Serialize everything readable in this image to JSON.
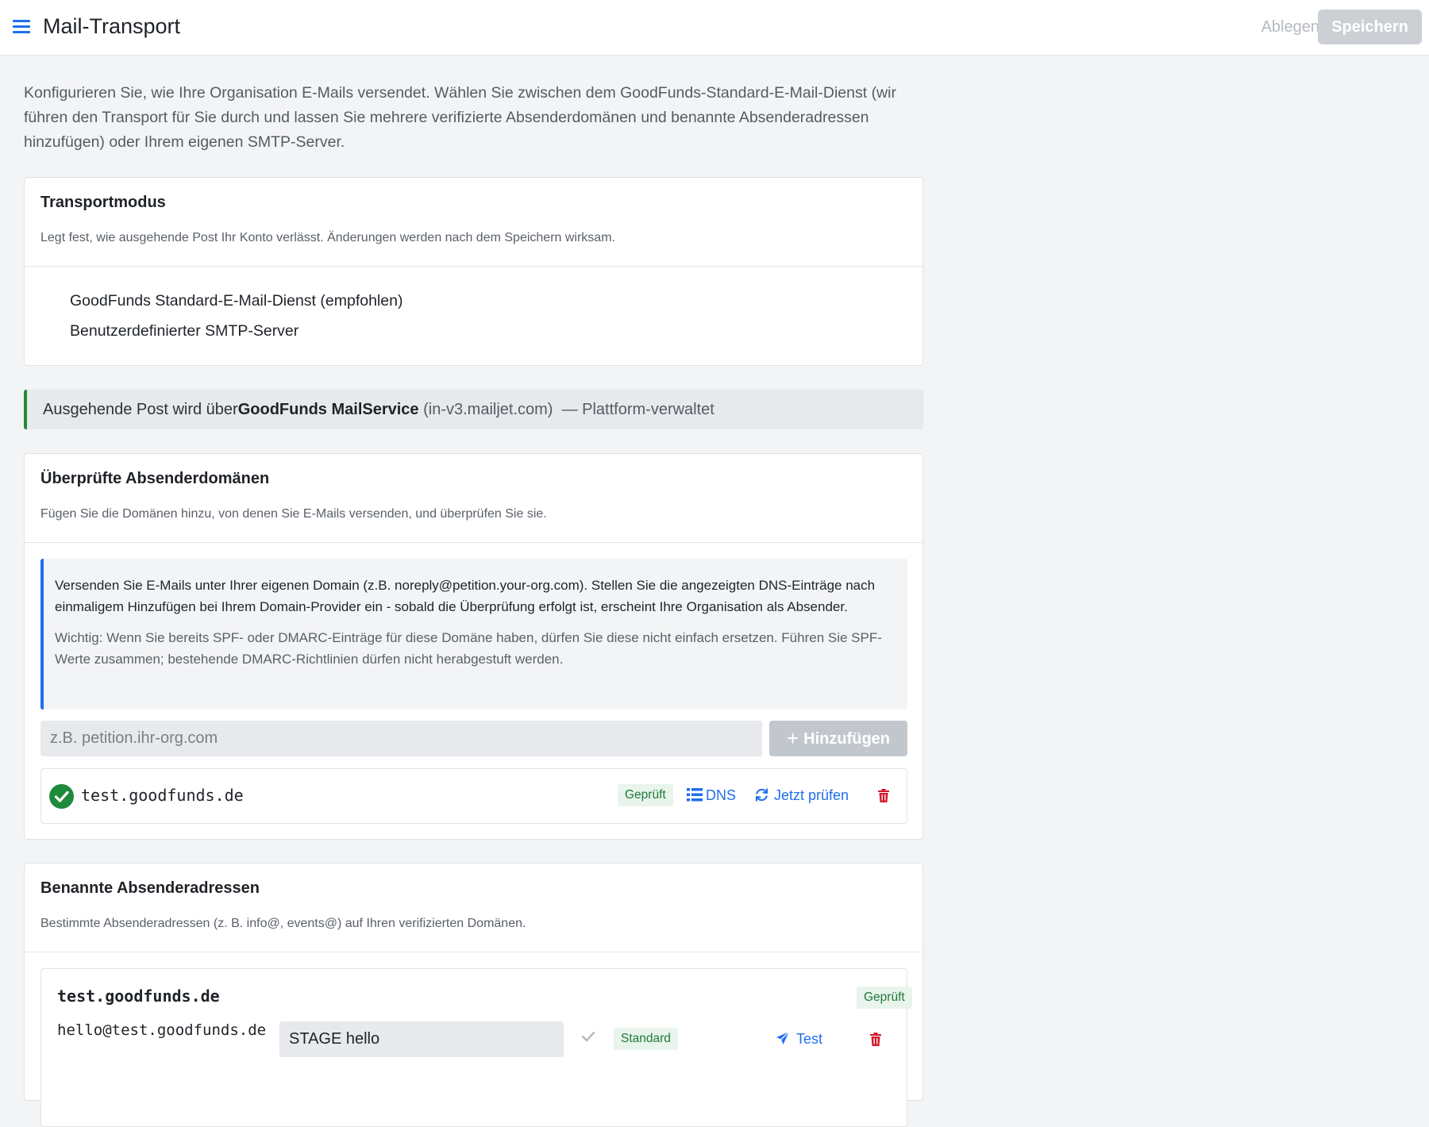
{
  "header": {
    "title": "Mail-Transport",
    "discard_label": "Ablegen",
    "save_label": "Speichern"
  },
  "intro": "Konfigurieren Sie, wie Ihre Organisation E-Mails versendet. Wählen Sie zwischen dem GoodFunds-Standard-E-Mail-Dienst (wir führen den Transport für Sie durch und lassen Sie mehrere verifizierte Absenderdomänen und benannte Absenderadressen hinzufügen) oder Ihrem eigenen SMTP-Server.",
  "transport_mode": {
    "title": "Transportmodus",
    "subtitle": "Legt fest, wie ausgehende Post Ihr Konto verlässt. Änderungen werden nach dem Speichern wirksam.",
    "options": [
      {
        "label": "GoodFunds Standard-E-Mail-Dienst (empfohlen)"
      },
      {
        "label": "Benutzerdefinierter SMTP-Server"
      }
    ]
  },
  "transport_banner": {
    "prefix": "Ausgehende Post wird über",
    "service": "GoodFunds MailService",
    "host": "(in-v3.mailjet.com)",
    "suffix": "— Plattform-verwaltet"
  },
  "sender_domains": {
    "title": "Überprüfte Absenderdomänen",
    "subtitle": "Fügen Sie die Domänen hinzu, von denen Sie E-Mails versenden, und überprüfen Sie sie.",
    "info_main": "Versenden Sie E-Mails unter Ihrer eigenen Domain (z.B. noreply@petition.your-org.com). Stellen Sie die angezeigten DNS-Einträge nach einmaligem Hinzufügen bei Ihrem Domain-Provider ein - sobald die Überprüfung erfolgt ist, erscheint Ihre Organisation als Absender.",
    "info_warning": "Wichtig: Wenn Sie bereits SPF- oder DMARC-Einträge für diese Domäne haben, dürfen Sie diese nicht einfach ersetzen. Führen Sie SPF-Werte zusammen; bestehende DMARC-Richtlinien dürfen nicht herabgestuft werden.",
    "input_placeholder": "z.B. petition.ihr-org.com",
    "add_label": "Hinzufügen",
    "domains": [
      {
        "name": "test.goodfunds.de",
        "status": "Geprüft",
        "dns_label": "DNS",
        "check_label": "Jetzt prüfen"
      }
    ]
  },
  "sender_addresses": {
    "title": "Benannte Absenderadressen",
    "subtitle": "Bestimmte Absenderadressen (z. B. info@, events@) auf Ihren verifizierten Domänen.",
    "groups": [
      {
        "domain": "test.goodfunds.de",
        "status": "Geprüft",
        "addresses": [
          {
            "address": "hello@test.goodfunds.de",
            "display_name": "STAGE hello",
            "default_badge": "Standard",
            "test_label": "Test"
          }
        ]
      }
    ]
  },
  "colors": {
    "accent": "#1f6feb",
    "success": "#1f8a3b",
    "danger": "#d11a2a",
    "background": "#f3f4f6"
  }
}
